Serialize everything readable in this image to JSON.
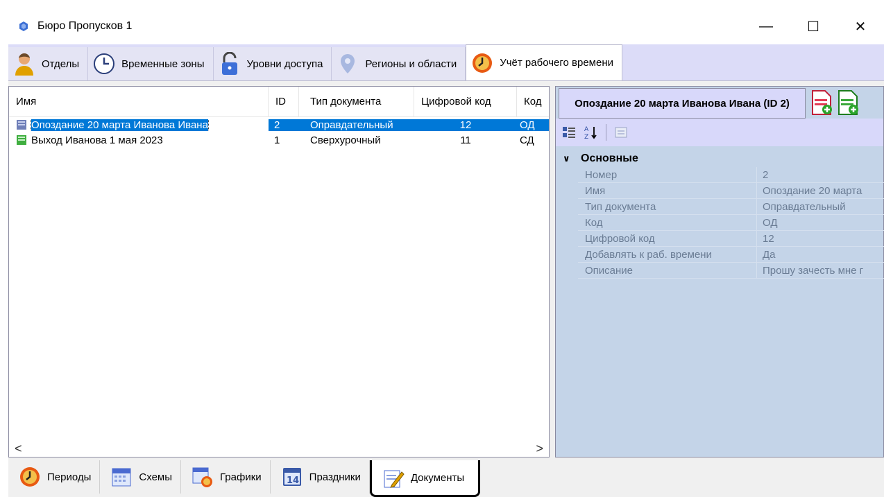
{
  "window": {
    "title": "Бюро Пропусков 1",
    "minimize": "—",
    "maximize": "☐",
    "close": "✕"
  },
  "top_tabs": [
    {
      "label": "Отделы",
      "icon": "person-icon"
    },
    {
      "label": "Временные зоны",
      "icon": "clock-icon"
    },
    {
      "label": "Уровни доступа",
      "icon": "padlock-icon"
    },
    {
      "label": "Регионы и области",
      "icon": "pin-icon"
    },
    {
      "label": "Учёт рабочего времени",
      "icon": "timer-icon",
      "active": true
    }
  ],
  "list": {
    "columns": [
      "Имя",
      "ID",
      "Тип документа",
      "Цифровой код",
      "Код"
    ],
    "rows": [
      {
        "name": "Опоздание 20 марта Иванова Ивана",
        "id": "2",
        "type": "Оправдательный",
        "digital_code": "12",
        "code": "ОД",
        "selected": true
      },
      {
        "name": "Выход Иванова 1 мая 2023",
        "id": "1",
        "type": "Сверхурочный",
        "digital_code": "11",
        "code": "СД",
        "selected": false
      }
    ],
    "scroll_left": "<",
    "scroll_right": ">"
  },
  "properties": {
    "header": "Опоздание 20 марта Иванова Ивана (ID 2)",
    "category": "Основные",
    "items": [
      {
        "key": "Номер",
        "value": "2"
      },
      {
        "key": "Имя",
        "value": "Опоздание 20 марта"
      },
      {
        "key": "Тип документа",
        "value": "Оправдательный"
      },
      {
        "key": "Код",
        "value": "ОД"
      },
      {
        "key": "Цифровой код",
        "value": "12"
      },
      {
        "key": "Добавлять к раб. времени",
        "value": "Да"
      },
      {
        "key": "Описание",
        "value": "Прошу зачесть мне г"
      }
    ]
  },
  "bottom_tabs": [
    {
      "label": "Периоды",
      "icon": "timer-icon"
    },
    {
      "label": "Схемы",
      "icon": "calendar-icon"
    },
    {
      "label": "Графики",
      "icon": "schedule-icon"
    },
    {
      "label": "Праздники",
      "icon": "holiday-calendar-icon"
    },
    {
      "label": "Документы",
      "icon": "document-edit-icon",
      "active": true
    }
  ],
  "colors": {
    "selection": "#0078d7",
    "tab_strip": "#dcdcf8",
    "props_bg": "#c4d4e8"
  }
}
